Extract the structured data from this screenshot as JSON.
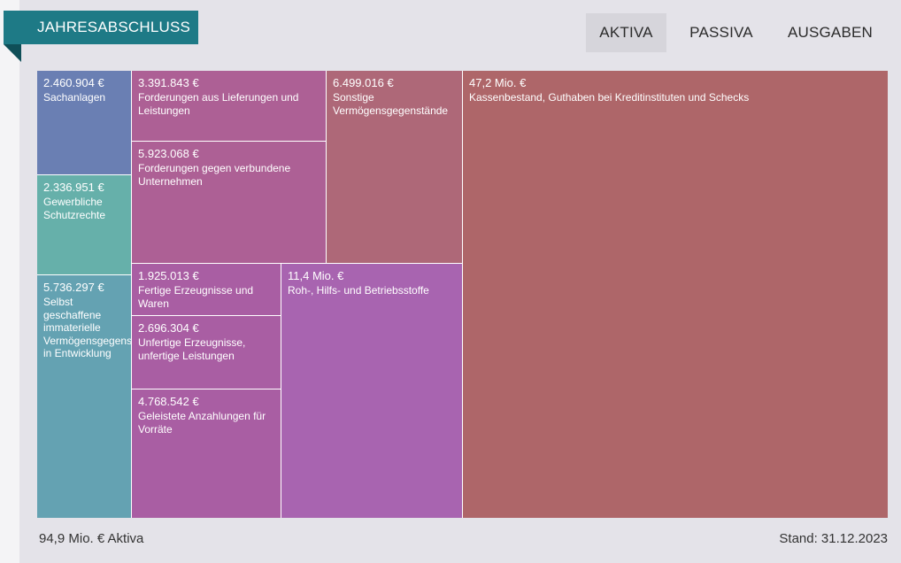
{
  "header": {
    "title": "JAHRESABSCHLUSS",
    "tabs": [
      {
        "label": "AKTIVA",
        "active": true
      },
      {
        "label": "PASSIVA",
        "active": false
      },
      {
        "label": "AUSGABEN",
        "active": false
      }
    ]
  },
  "footer": {
    "total_label": "94,9 Mio. € Aktiva",
    "date_label": "Stand: 31.12.2023"
  },
  "chart_data": {
    "type": "treemap",
    "title": "",
    "groups": [
      {
        "items": [
          {
            "value_label": "2.460.904 €",
            "name": "Sachanlagen",
            "value": 2460904,
            "color": "#6a7fb3"
          },
          {
            "value_label": "2.336.951 €",
            "name": "Gewerbliche Schutzrechte",
            "value": 2336951,
            "color": "#66b0aa"
          },
          {
            "value_label": "5.736.297 €",
            "name": "Selbst geschaffene immaterielle Vermögensgegenstände in Entwicklung",
            "value": 5736297,
            "color": "#64a2b2"
          }
        ]
      },
      {
        "items": [
          {
            "value_label": "3.391.843 €",
            "name": "Forderungen aus Lieferungen und Leistungen",
            "value": 3391843,
            "color": "#ad6095"
          },
          {
            "value_label": "5.923.068 €",
            "name": "Forderungen gegen verbundene Unternehmen",
            "value": 5923068,
            "color": "#ad6095"
          },
          {
            "value_label": "6.499.016 €",
            "name": "Sonstige Vermögensgegenstände",
            "value": 6499016,
            "color": "#ae6878"
          }
        ]
      },
      {
        "items": [
          {
            "value_label": "1.925.013 €",
            "name": "Fertige Erzeugnisse und Waren",
            "value": 1925013,
            "color": "#a95ea3"
          },
          {
            "value_label": "2.696.304 €",
            "name": "Unfertige Erzeugnisse, unfertige Leistungen",
            "value": 2696304,
            "color": "#a95ea3"
          },
          {
            "value_label": "4.768.542 €",
            "name": "Geleistete Anzahlungen für Vorräte",
            "value": 4768542,
            "color": "#a95ea3"
          },
          {
            "value_label": "11,4 Mio. €",
            "name": "Roh-, Hilfs- und Betriebsstoffe",
            "value": 11400000,
            "color": "#a864b0"
          }
        ]
      },
      {
        "items": [
          {
            "value_label": "47,2 Mio. €",
            "name": "Kassenbestand, Guthaben bei Kreditinstituten und Schecks",
            "value": 47200000,
            "color": "#ae6669"
          }
        ]
      }
    ]
  }
}
